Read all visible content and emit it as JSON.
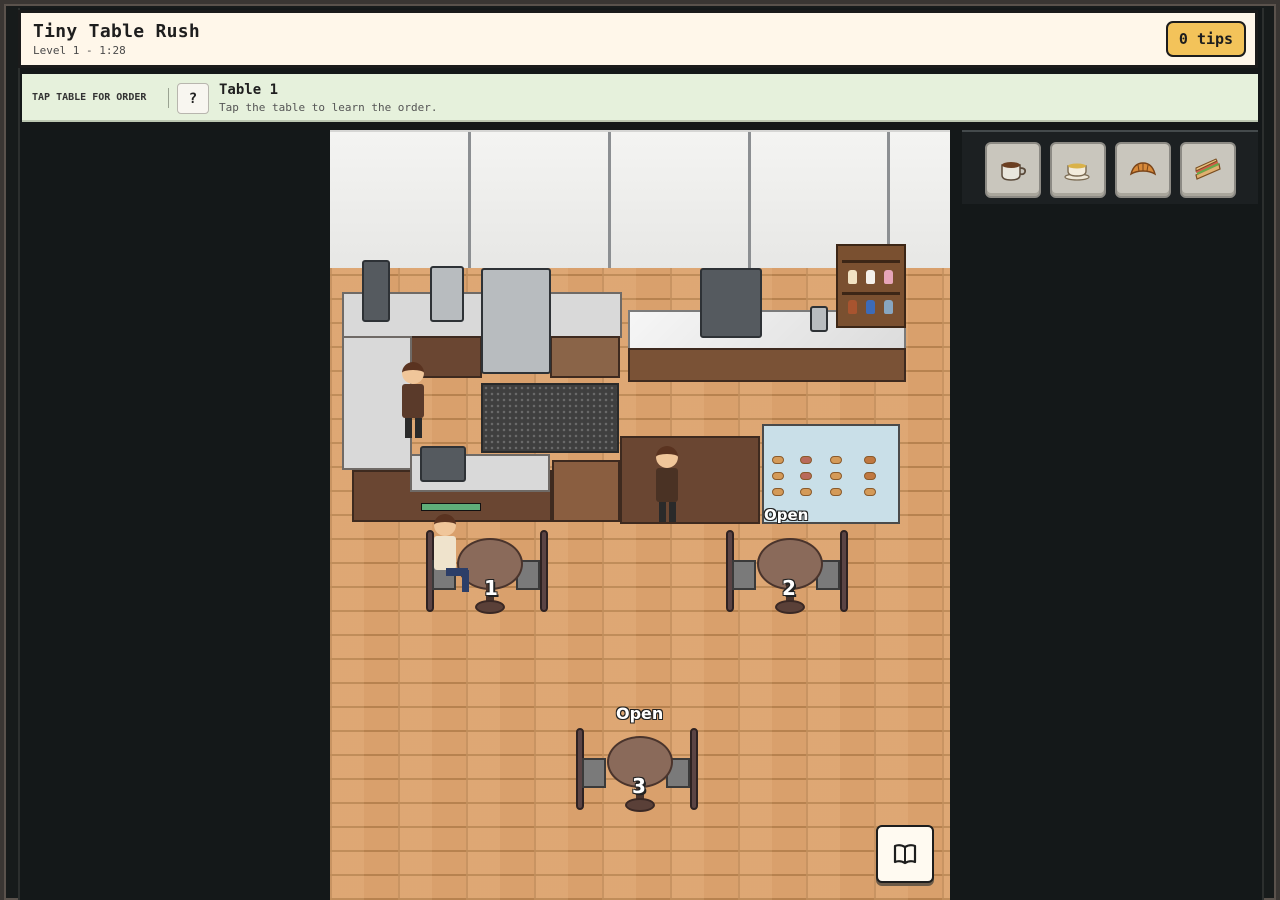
{
  "header": {
    "title": "Tiny Table Rush",
    "subtitle": "Level 1 - 1:28",
    "tips": "0 tips"
  },
  "hint": {
    "label": "TAP TABLE FOR ORDER",
    "help": "?",
    "title": "Table 1",
    "sub": "Tap the table to learn the order."
  },
  "scene": {
    "display_case_status": "Open",
    "tables": [
      {
        "number": "1",
        "status": "occupied"
      },
      {
        "number": "2",
        "status": ""
      },
      {
        "number": "3",
        "status": "Open"
      }
    ],
    "patience": 1.0
  },
  "items": [
    {
      "name": "coffee-icon"
    },
    {
      "name": "tea-icon"
    },
    {
      "name": "croissant-icon"
    },
    {
      "name": "sandwich-icon"
    }
  ],
  "recipe_book": "book-icon",
  "colors": {
    "header_bg": "#fff7ea",
    "tips_badge": "#f3c35a",
    "hint_bg": "#e6f1dc",
    "floor": "#d9a06c",
    "patience_bar": "#5fae7a"
  }
}
